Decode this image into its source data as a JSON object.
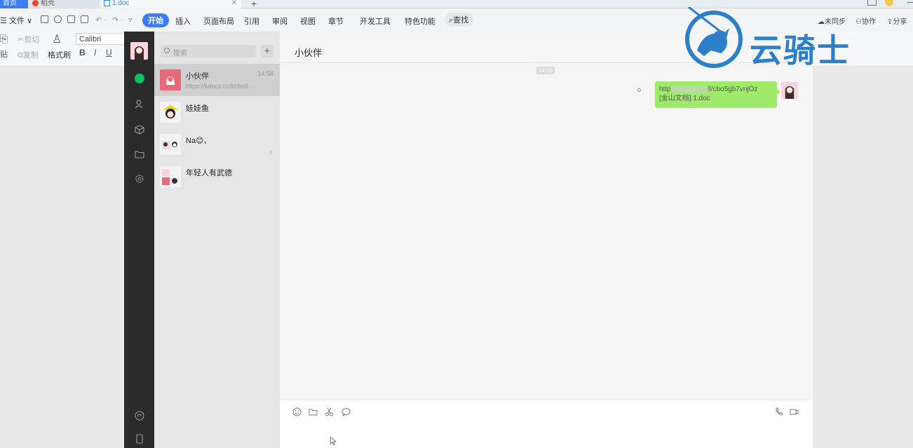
{
  "wps": {
    "tabs": [
      "首页",
      "稻壳",
      "1.doc"
    ],
    "tab_close": "✕",
    "tab_add": "+",
    "menu": {
      "file": "☰ 文件 ∨",
      "items": [
        "开始",
        "插入",
        "页面布局",
        "引用",
        "审阅",
        "视图",
        "章节",
        "开发工具",
        "特色功能"
      ],
      "search": "查找",
      "right": [
        "未同步",
        "协作",
        "分享"
      ]
    },
    "toolbar": {
      "cut": "剪切",
      "copy": "复制",
      "paste": "贴",
      "format_painter": "格式刷",
      "font": "Calibri",
      "bold": "B",
      "italic": "I",
      "underline": "U"
    }
  },
  "wechat": {
    "search_placeholder": "搜索",
    "add_label": "+",
    "conversations": [
      {
        "name": "小伙伴",
        "time": "14:58",
        "preview": "https://kdocs.cn/l/cbo5..."
      },
      {
        "name": "娃娃鱼",
        "time": "",
        "preview": ""
      },
      {
        "name": "Na😊、",
        "time": "",
        "preview": ""
      },
      {
        "name": "年轻人有武德",
        "time": "",
        "preview": ""
      }
    ],
    "chat": {
      "title": "小伙伴",
      "more": "···",
      "time": "14:58",
      "message_line1_prefix": "http",
      "message_line1_suffix": "/l/cbo5gb7vnjOz",
      "message_line2": "[金山文档] 1.doc"
    }
  },
  "watermark": {
    "text": "云骑士"
  },
  "colors": {
    "wps_accent": "#3d7ef6",
    "wechat_green": "#07c160",
    "bubble": "#9eea6a",
    "watermark": "#2c7fc9"
  }
}
